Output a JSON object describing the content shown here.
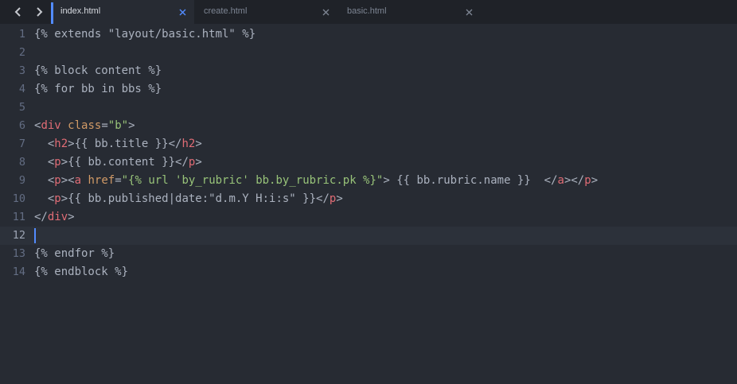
{
  "theme": {
    "background": "#272b33",
    "tabbar": "#1f2228",
    "accent": "#528bff",
    "current_line": "#2c313a"
  },
  "nav": {
    "back_icon": "chevron-left-icon",
    "forward_icon": "chevron-right-icon"
  },
  "tabs": [
    {
      "label": "index.html",
      "active": true,
      "close_icon": "close-icon"
    },
    {
      "label": "create.html",
      "active": false,
      "close_icon": "close-icon"
    },
    {
      "label": "basic.html",
      "active": false,
      "close_icon": "close-icon"
    }
  ],
  "token_colors": {
    "plain": "#abb2bf",
    "tag": "#e06c75",
    "attr": "#d19a66",
    "string": "#98c379",
    "punct": "#abb2bf"
  },
  "editor": {
    "current_line": 12,
    "lines": [
      {
        "num": "1",
        "tokens": [
          {
            "t": "{% extends \"layout/basic.html\" %}",
            "c": "plain"
          }
        ]
      },
      {
        "num": "2",
        "tokens": []
      },
      {
        "num": "3",
        "tokens": [
          {
            "t": "{% block content %}",
            "c": "plain"
          }
        ]
      },
      {
        "num": "4",
        "tokens": [
          {
            "t": "{% for bb in bbs %}",
            "c": "plain"
          }
        ]
      },
      {
        "num": "5",
        "tokens": []
      },
      {
        "num": "6",
        "tokens": [
          {
            "t": "<",
            "c": "punct"
          },
          {
            "t": "div",
            "c": "tag"
          },
          {
            "t": " ",
            "c": "plain"
          },
          {
            "t": "class",
            "c": "attr"
          },
          {
            "t": "=",
            "c": "punct"
          },
          {
            "t": "\"b\"",
            "c": "string"
          },
          {
            "t": ">",
            "c": "punct"
          }
        ]
      },
      {
        "num": "7",
        "tokens": [
          {
            "t": "  <",
            "c": "punct"
          },
          {
            "t": "h2",
            "c": "tag"
          },
          {
            "t": ">{{ bb.title }}</",
            "c": "punct"
          },
          {
            "t": "h2",
            "c": "tag"
          },
          {
            "t": ">",
            "c": "punct"
          }
        ]
      },
      {
        "num": "8",
        "tokens": [
          {
            "t": "  <",
            "c": "punct"
          },
          {
            "t": "p",
            "c": "tag"
          },
          {
            "t": ">{{ bb.content }}</",
            "c": "punct"
          },
          {
            "t": "p",
            "c": "tag"
          },
          {
            "t": ">",
            "c": "punct"
          }
        ]
      },
      {
        "num": "9",
        "tokens": [
          {
            "t": "  <",
            "c": "punct"
          },
          {
            "t": "p",
            "c": "tag"
          },
          {
            "t": "><",
            "c": "punct"
          },
          {
            "t": "a",
            "c": "tag"
          },
          {
            "t": " ",
            "c": "plain"
          },
          {
            "t": "href",
            "c": "attr"
          },
          {
            "t": "=",
            "c": "punct"
          },
          {
            "t": "\"{% url 'by_rubric' bb.by_rubric.pk %}\"",
            "c": "string"
          },
          {
            "t": "> {{ bb.rubric.name }}  </",
            "c": "punct"
          },
          {
            "t": "a",
            "c": "tag"
          },
          {
            "t": "></",
            "c": "punct"
          },
          {
            "t": "p",
            "c": "tag"
          },
          {
            "t": ">",
            "c": "punct"
          }
        ]
      },
      {
        "num": "10",
        "tokens": [
          {
            "t": "  <",
            "c": "punct"
          },
          {
            "t": "p",
            "c": "tag"
          },
          {
            "t": ">{{ bb.published|date:\"d.m.Y H:i:s\" }}</",
            "c": "punct"
          },
          {
            "t": "p",
            "c": "tag"
          },
          {
            "t": ">",
            "c": "punct"
          }
        ]
      },
      {
        "num": "11",
        "tokens": [
          {
            "t": "</",
            "c": "punct"
          },
          {
            "t": "div",
            "c": "tag"
          },
          {
            "t": ">",
            "c": "punct"
          }
        ]
      },
      {
        "num": "12",
        "tokens": []
      },
      {
        "num": "13",
        "tokens": [
          {
            "t": "{% endfor %}",
            "c": "plain"
          }
        ]
      },
      {
        "num": "14",
        "tokens": [
          {
            "t": "{% endblock %}",
            "c": "plain"
          }
        ]
      }
    ]
  }
}
